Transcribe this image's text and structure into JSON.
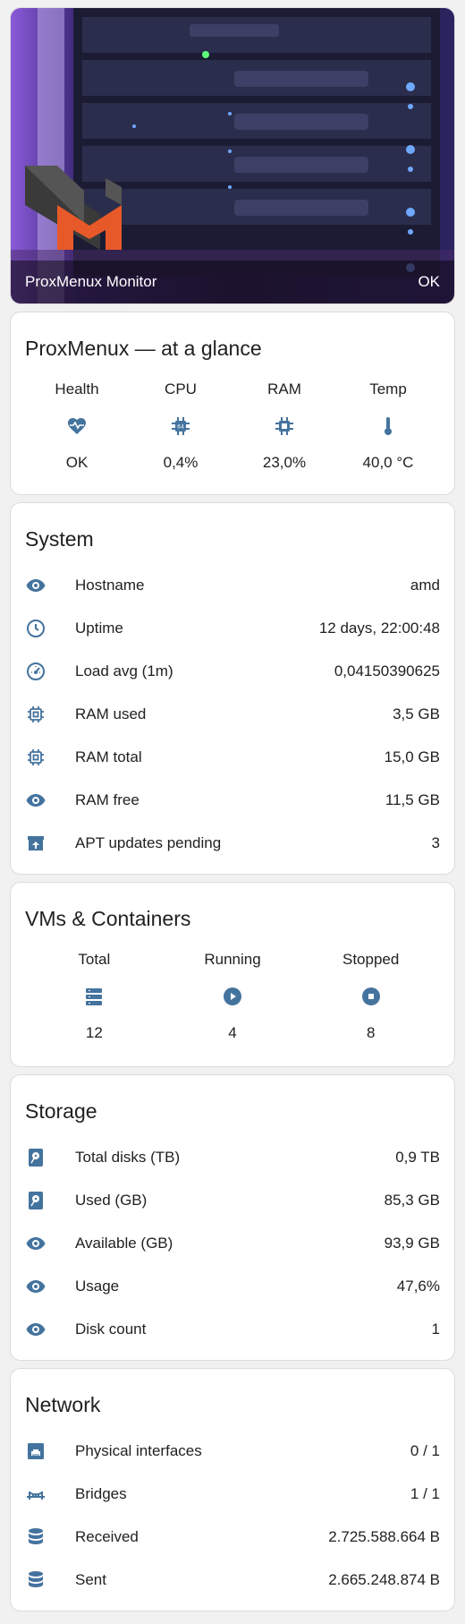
{
  "hero": {
    "title": "ProxMenux Monitor",
    "status": "OK"
  },
  "glance": {
    "title": "ProxMenux — at a glance",
    "items": [
      {
        "label": "Health",
        "value": "OK",
        "icon": "heart-pulse-icon"
      },
      {
        "label": "CPU",
        "value": "0,4%",
        "icon": "cpu-chip-icon"
      },
      {
        "label": "RAM",
        "value": "23,0%",
        "icon": "memory-chip-icon"
      },
      {
        "label": "Temp",
        "value": "40,0 °C",
        "icon": "thermometer-icon"
      }
    ]
  },
  "system": {
    "title": "System",
    "rows": [
      {
        "label": "Hostname",
        "value": "amd",
        "icon": "eye-icon"
      },
      {
        "label": "Uptime",
        "value": "12 days, 22:00:48",
        "icon": "clock-icon"
      },
      {
        "label": "Load avg (1m)",
        "value": "0,04150390625",
        "icon": "gauge-icon"
      },
      {
        "label": "RAM used",
        "value": "3,5 GB",
        "icon": "chip-icon"
      },
      {
        "label": "RAM total",
        "value": "15,0 GB",
        "icon": "chip-icon"
      },
      {
        "label": "RAM free",
        "value": "11,5 GB",
        "icon": "eye-icon"
      },
      {
        "label": "APT updates pending",
        "value": "3",
        "icon": "package-up-icon"
      }
    ]
  },
  "vms": {
    "title": "VMs & Containers",
    "items": [
      {
        "label": "Total",
        "value": "12",
        "icon": "server-icon"
      },
      {
        "label": "Running",
        "value": "4",
        "icon": "play-circle-icon"
      },
      {
        "label": "Stopped",
        "value": "8",
        "icon": "stop-circle-icon"
      }
    ]
  },
  "storage": {
    "title": "Storage",
    "rows": [
      {
        "label": "Total disks (TB)",
        "value": "0,9 TB",
        "icon": "harddisk-icon"
      },
      {
        "label": "Used (GB)",
        "value": "85,3 GB",
        "icon": "harddisk-icon"
      },
      {
        "label": "Available (GB)",
        "value": "93,9 GB",
        "icon": "eye-icon"
      },
      {
        "label": "Usage",
        "value": "47,6%",
        "icon": "eye-icon"
      },
      {
        "label": "Disk count",
        "value": "1",
        "icon": "eye-icon"
      }
    ]
  },
  "network": {
    "title": "Network",
    "rows": [
      {
        "label": "Physical interfaces",
        "value": "0 / 1",
        "icon": "ethernet-icon"
      },
      {
        "label": "Bridges",
        "value": "1 / 1",
        "icon": "bridge-icon"
      },
      {
        "label": "Received",
        "value": "2.725.588.664 B",
        "icon": "database-icon"
      },
      {
        "label": "Sent",
        "value": "2.665.248.874 B",
        "icon": "database-icon"
      }
    ]
  },
  "colors": {
    "icon": "#44739e",
    "card_bg": "#ffffff",
    "page_bg": "#f1f1f1"
  }
}
